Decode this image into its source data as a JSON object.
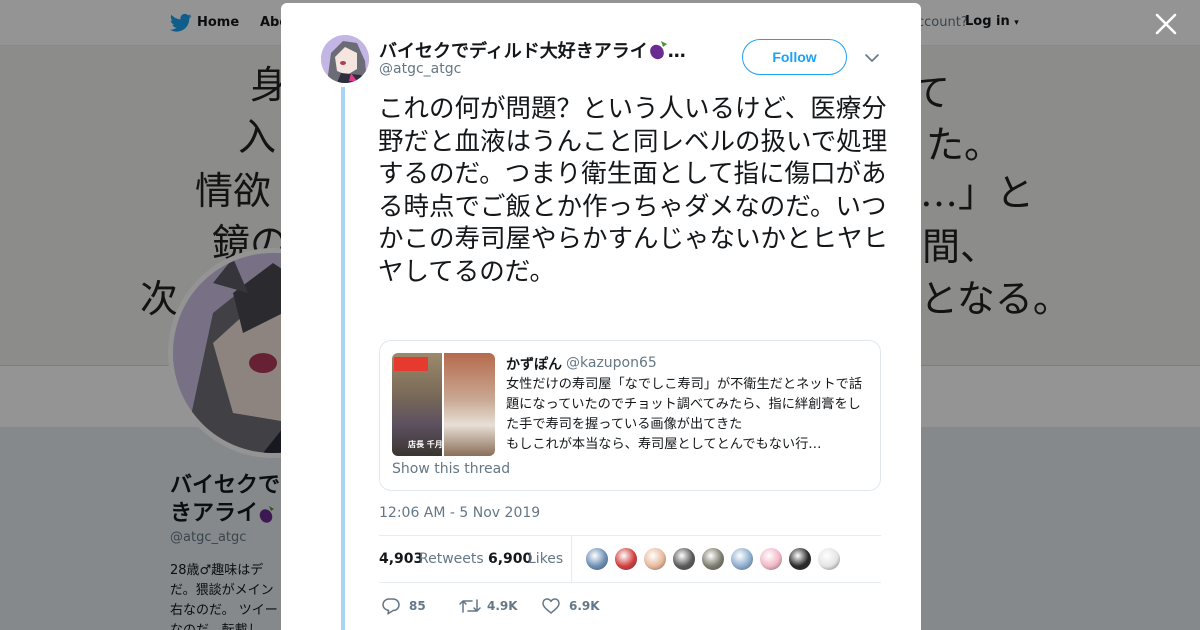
{
  "background": {
    "nav": {
      "home_label": "Home",
      "about_label": "Abo",
      "account_text": "ccount?",
      "login_label": "Log in"
    },
    "banner": {
      "left_lines": [
        "身",
        "入",
        "情欲",
        "鏡の",
        "次"
      ],
      "right_lines": [
        "て",
        "た。",
        "…」と",
        "間、",
        "となる。"
      ]
    },
    "profile": {
      "name": "バイセクでディルド大好きアライ🍆",
      "name_lines": [
        "バイセクで",
        "きアライ"
      ],
      "handle": "@atgc_atgc",
      "bio_lines": [
        "28歳♂趣味はデ",
        "だ。猥談がメイン",
        "右なのだ。 ツイー",
        "なのだ。転載し"
      ]
    }
  },
  "modal": {
    "close_label": "×",
    "author": {
      "name": "バイセクでディルド大好きアライ",
      "name_suffix": "…",
      "handle": "@atgc_atgc"
    },
    "follow_label": "Follow",
    "tweet_text": "これの何が問題？という人いるけど、医療分野だと血液はうんこと同レベルの扱いで処理するのだ。つまり衛生面として指に傷口がある時点でご飯とか作っちゃダメなのだ。いつかこの寿司屋やらかすんじゃないかとヒヤヒヤしてるのだ。",
    "quote": {
      "name": "かずぽん",
      "handle": "@kazupon65",
      "text": "女性だけの寿司屋「なでしこ寿司」が不衛生だとネットで話題になっていたのでチョット調べてみたら、指に絆創膏をした手で寿司を握っている画像が出てきた\nもしこれが本当なら、寿司屋としてとんでもない行…",
      "thumb_label": "店長 千月",
      "show_thread_label": "Show this thread"
    },
    "timestamp": "12:06 AM - 5 Nov 2019",
    "stats": {
      "retweets_count": "4,903",
      "retweets_label": "Retweets",
      "likes_count": "6,900",
      "likes_label": "Likes"
    },
    "actions": {
      "reply_count": "85",
      "retweet_count": "4.9K",
      "like_count": "6.9K"
    },
    "liker_avatars": [
      "#6d8fb5",
      "#d23f3f",
      "#e8b99c",
      "#5a5a5a",
      "#7d7d70",
      "#8eaed0",
      "#f2b7c6",
      "#2a2a2a",
      "#e4e4e4"
    ]
  }
}
